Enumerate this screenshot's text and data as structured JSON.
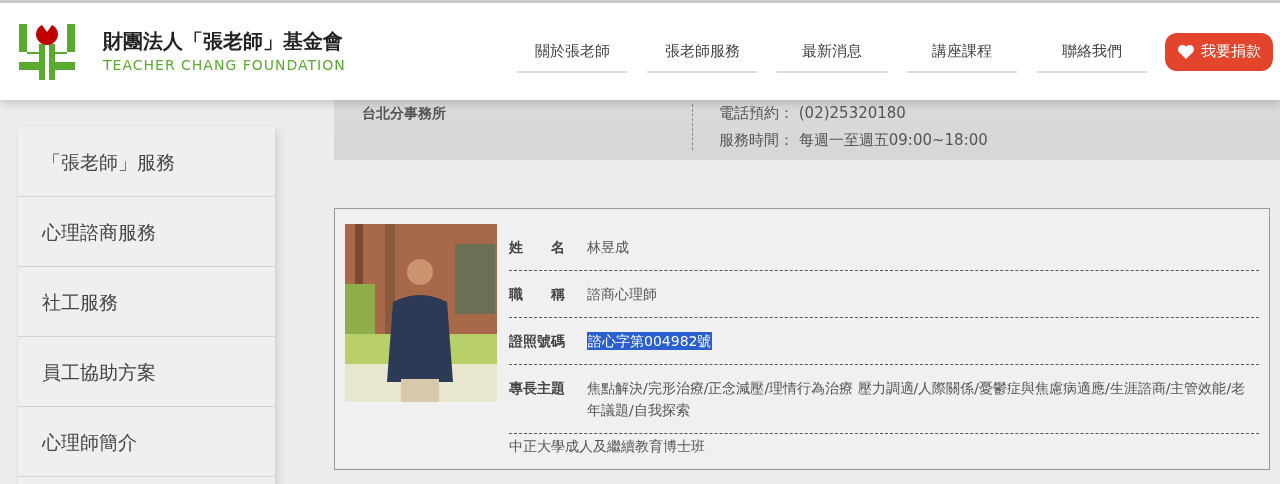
{
  "header": {
    "org_name": "財團法人「張老師」基金會",
    "org_name_en": "TEACHER CHANG FOUNDATION",
    "nav": [
      {
        "label": "關於張老師"
      },
      {
        "label": "張老師服務"
      },
      {
        "label": "最新消息"
      },
      {
        "label": "講座課程"
      },
      {
        "label": "聯絡我們"
      }
    ],
    "donate_button": "我要捐款"
  },
  "sidebar": {
    "items": [
      {
        "label": "「張老師」服務"
      },
      {
        "label": "心理諮商服務"
      },
      {
        "label": "社工服務"
      },
      {
        "label": "員工協助方案"
      },
      {
        "label": "心理師簡介"
      }
    ]
  },
  "office": {
    "name": "台北分事務所",
    "lines": [
      {
        "label": "電話預約：",
        "value": "(02)25320180"
      },
      {
        "label": "服務時間：",
        "value": "每週一至週五09:00~18:00"
      }
    ]
  },
  "profile": {
    "fields": [
      {
        "label": "姓　　名",
        "value": "林昱成",
        "highlighted": false
      },
      {
        "label": "職　　稱",
        "value": "諮商心理師",
        "highlighted": false
      },
      {
        "label": "證照號碼",
        "value": "諮心字第004982號",
        "highlighted": true
      },
      {
        "label": "專長主題",
        "value": "焦點解決/完形治療/正念減壓/理情行為治療 壓力調適/人際關係/憂鬱症與焦慮病適應/生涯諮商/主管效能/老年議題/自我探索",
        "highlighted": false
      }
    ],
    "education": "中正大學成人及繼續教育博士班"
  }
}
